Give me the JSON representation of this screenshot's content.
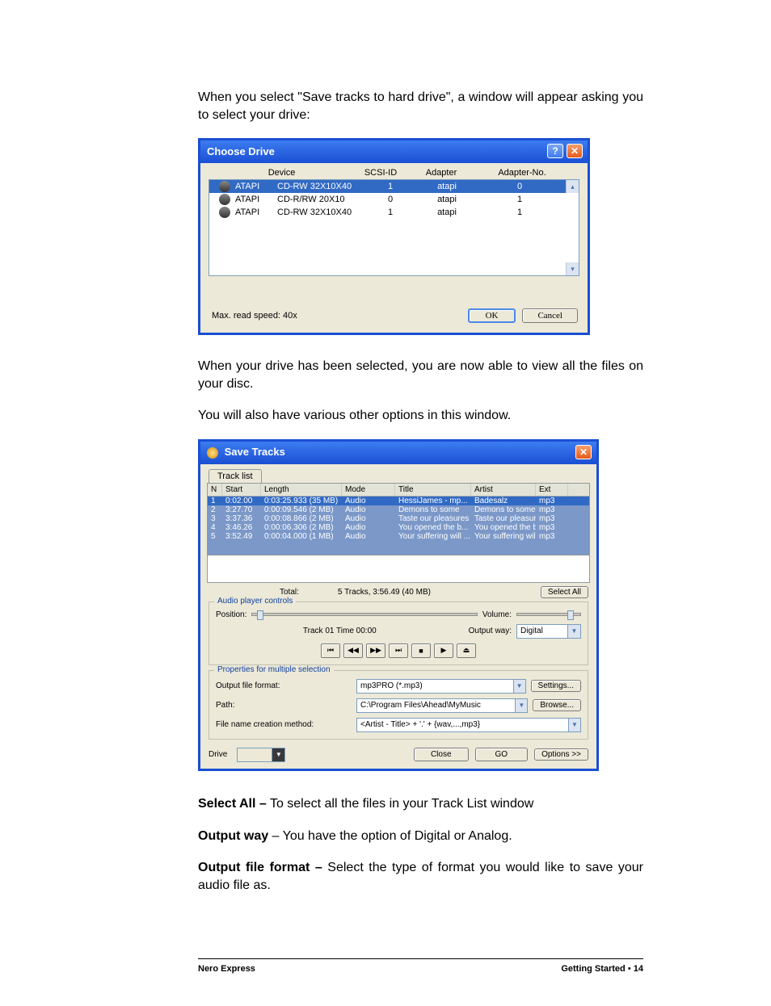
{
  "para1": "When you select \"Save tracks to hard drive\", a window will appear asking you to select your drive:",
  "chooseDrive": {
    "title": "Choose Drive",
    "help": "?",
    "close": "✕",
    "cols": {
      "device": "Device",
      "scsi": "SCSI-ID",
      "adapter": "Adapter",
      "adno": "Adapter-No."
    },
    "rows": [
      {
        "dev": "ATAPI",
        "model": "CD-RW 32X10X40",
        "scsi": "1",
        "adp": "atapi",
        "ano": "0",
        "sel": true
      },
      {
        "dev": "ATAPI",
        "model": "CD-R/RW 20X10",
        "scsi": "0",
        "adp": "atapi",
        "ano": "1",
        "sel": false
      },
      {
        "dev": "ATAPI",
        "model": "CD-RW 32X10X40",
        "scsi": "1",
        "adp": "atapi",
        "ano": "1",
        "sel": false
      }
    ],
    "maxRead": "Max. read speed: 40x",
    "ok": "OK",
    "cancel": "Cancel"
  },
  "para2": "When your drive has been selected, you are now able to view all the files on your disc.",
  "para3": "You will also have various other options in this window.",
  "saveTracks": {
    "title": "Save Tracks",
    "close": "✕",
    "tab": "Track list",
    "hdr": {
      "n": "N",
      "start": "Start",
      "len": "Length",
      "mode": "Mode",
      "title": "Title",
      "artist": "Artist",
      "ext": "Ext"
    },
    "rows": [
      {
        "n": "1",
        "start": "0:02.00",
        "len": "0:03:25.933 (35 MB)",
        "mode": "Audio",
        "title": "HessiJames - mp...",
        "artist": "Badesalz",
        "ext": "mp3"
      },
      {
        "n": "2",
        "start": "3:27.70",
        "len": "0:00:09.546 (2 MB)",
        "mode": "Audio",
        "title": "Demons to some",
        "artist": "Demons to some",
        "ext": "mp3"
      },
      {
        "n": "3",
        "start": "3:37.36",
        "len": "0:00:08.866 (2 MB)",
        "mode": "Audio",
        "title": "Taste our pleasures",
        "artist": "Taste our pleasures",
        "ext": "mp3"
      },
      {
        "n": "4",
        "start": "3:46.26",
        "len": "0:00:06.306 (2 MB)",
        "mode": "Audio",
        "title": "You opened the b...",
        "artist": "You opened the b...",
        "ext": "mp3"
      },
      {
        "n": "5",
        "start": "3:52.49",
        "len": "0:00:04.000 (1 MB)",
        "mode": "Audio",
        "title": "Your suffering will ...",
        "artist": "Your suffering will ...",
        "ext": "mp3"
      }
    ],
    "totalLabel": "Total:",
    "totalValue": "5 Tracks,   3:56.49 (40 MB)",
    "selectAll": "Select All",
    "audioGroup": "Audio player controls",
    "position": "Position:",
    "trackTime": "Track 01 Time 00:00",
    "volume": "Volume:",
    "outputWay": "Output way:",
    "outputWayValue": "Digital",
    "propsGroup": "Properties for multiple selection",
    "outFmtLabel": "Output file format:",
    "outFmtValue": "mp3PRO (*.mp3)",
    "settings": "Settings...",
    "pathLabel": "Path:",
    "pathValue": "C:\\Program Files\\Ahead\\MyMusic",
    "browse": "Browse...",
    "fncLabel": "File name creation method:",
    "fncValue": "<Artist - Title> + '.' + {wav,...,mp3}",
    "driveLabel": "Drive",
    "closeBtn": "Close",
    "go": "GO",
    "options": "Options >>",
    "icons": {
      "prev": "⏮",
      "rew": "◀◀",
      "ffwd": "▶▶",
      "next": "⏭",
      "stop": "■",
      "play": "▶",
      "eject": "⏏"
    }
  },
  "desc": {
    "selAllB": "Select All –",
    "selAll": " To select all the files in your Track List window",
    "owB": "Output way",
    "ow": " – You have the option of Digital or Analog.",
    "offB": "Output file format –",
    "off": " Select the type of format you would like to save your audio file as."
  },
  "footer": {
    "left": "Nero Express",
    "rightLabel": "Getting Started",
    "bullet": "•",
    "page": "14"
  }
}
